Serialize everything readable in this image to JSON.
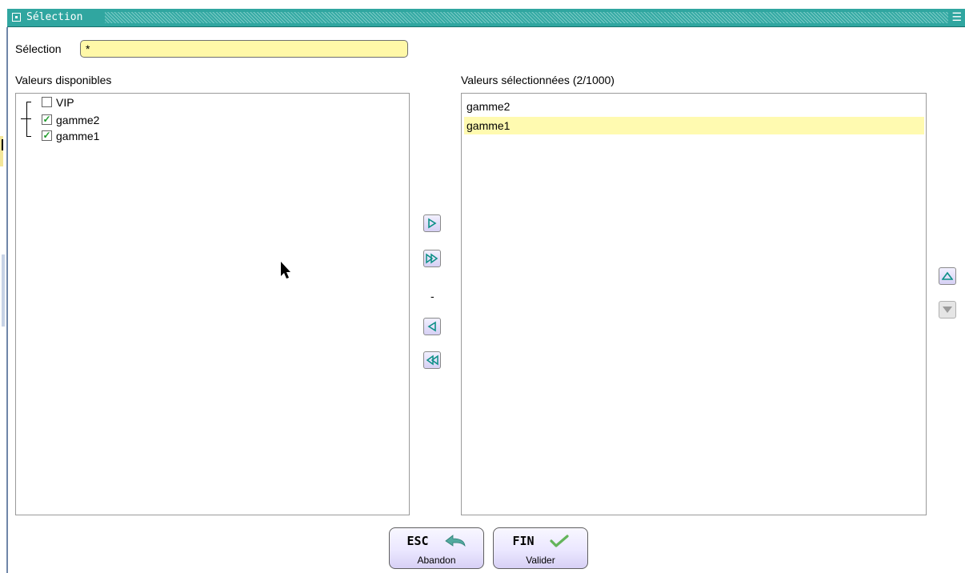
{
  "window": {
    "title": "Sélection",
    "menu_glyph": "☰"
  },
  "selection": {
    "label": "Sélection",
    "value": "*"
  },
  "available": {
    "label": "Valeurs disponibles",
    "items": [
      {
        "label": "VIP",
        "checked": false
      },
      {
        "label": "gamme2",
        "checked": true
      },
      {
        "label": "gamme1",
        "checked": true
      }
    ]
  },
  "chosen": {
    "label": "Valeurs sélectionnées (2/1000)",
    "items": [
      {
        "label": "gamme2",
        "selected": false
      },
      {
        "label": "gamme1",
        "selected": true
      }
    ]
  },
  "transfer": {
    "separator": "-",
    "icons": [
      "arrow-right-icon",
      "double-arrow-right-icon",
      "arrow-left-icon",
      "double-arrow-left-icon"
    ]
  },
  "order": {
    "icons": [
      "arrow-up-icon",
      "arrow-down-icon"
    ]
  },
  "actions": {
    "esc": {
      "key": "ESC",
      "label": "Abandon"
    },
    "fin": {
      "key": "FIN",
      "label": "Valider"
    }
  },
  "colors": {
    "titlebar": "#30a6a0",
    "input_bg": "#fff8a8",
    "selected_row": "#fffab0",
    "arrow": "#0b8f86",
    "check": "#1d9a2a"
  }
}
